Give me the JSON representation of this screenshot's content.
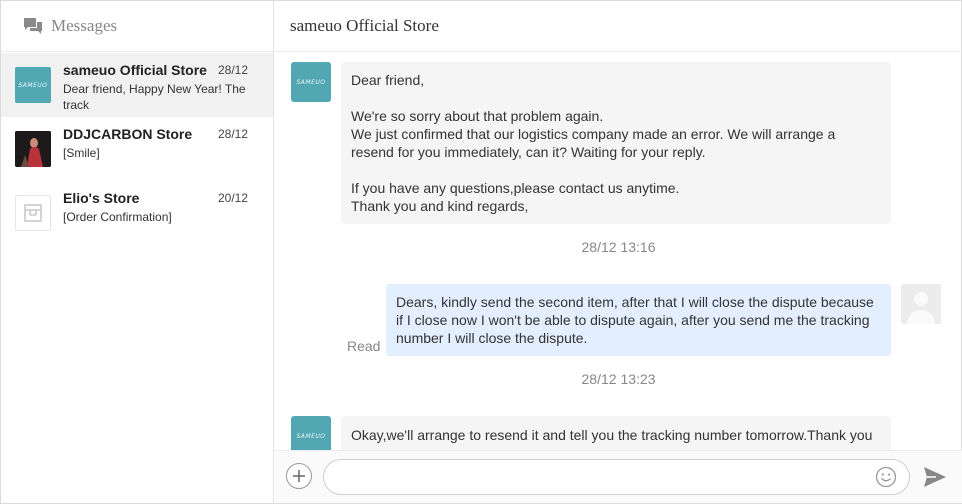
{
  "sidebar": {
    "title": "Messages",
    "title_icon": "chat-bubbles-icon",
    "conversations": [
      {
        "name": "sameuo Official Store",
        "date": "28/12",
        "preview": "Dear friend, Happy New Year! The track",
        "avatar_text": "SAMEUO",
        "avatar_color": "#52a7b3",
        "active": true
      },
      {
        "name": "DDJCARBON Store",
        "date": "28/12",
        "preview": "[Smile]",
        "avatar_color": "#1e1a1c",
        "active": false
      },
      {
        "name": "Elio's Store",
        "date": "20/12",
        "preview": "[Order Confirmation]",
        "avatar_icon": "store-icon",
        "active": false
      }
    ]
  },
  "chat": {
    "title": "sameuo Official Store",
    "messages": [
      {
        "from": "store",
        "text": "Dear friend,\n\nWe're so sorry about that problem again.\nWe just confirmed that our logistics company made an error. We will arrange a\nresend for you immediately, can it? Waiting for your reply.\n\nIf you have any questions,please contact us anytime.\nThank you and kind regards,"
      },
      {
        "timestamp": "28/12 13:16"
      },
      {
        "from": "me",
        "status": "Read",
        "text": "Dears, kindly send the second item, after that I will close the dispute because\nif I close now I won't be able to dispute again, after you send me the tracking\nnumber I will close the dispute."
      },
      {
        "timestamp": "28/12 13:23"
      },
      {
        "from": "store",
        "text": "Okay,we'll arrange to resend it and tell you the tracking number tomorrow.Thank you"
      }
    ]
  },
  "composer": {
    "placeholder": "",
    "value": ""
  },
  "colors": {
    "accent_avatar": "#52a7b3",
    "my_bubble": "#e3efff",
    "their_bubble": "#f5f5f5"
  }
}
